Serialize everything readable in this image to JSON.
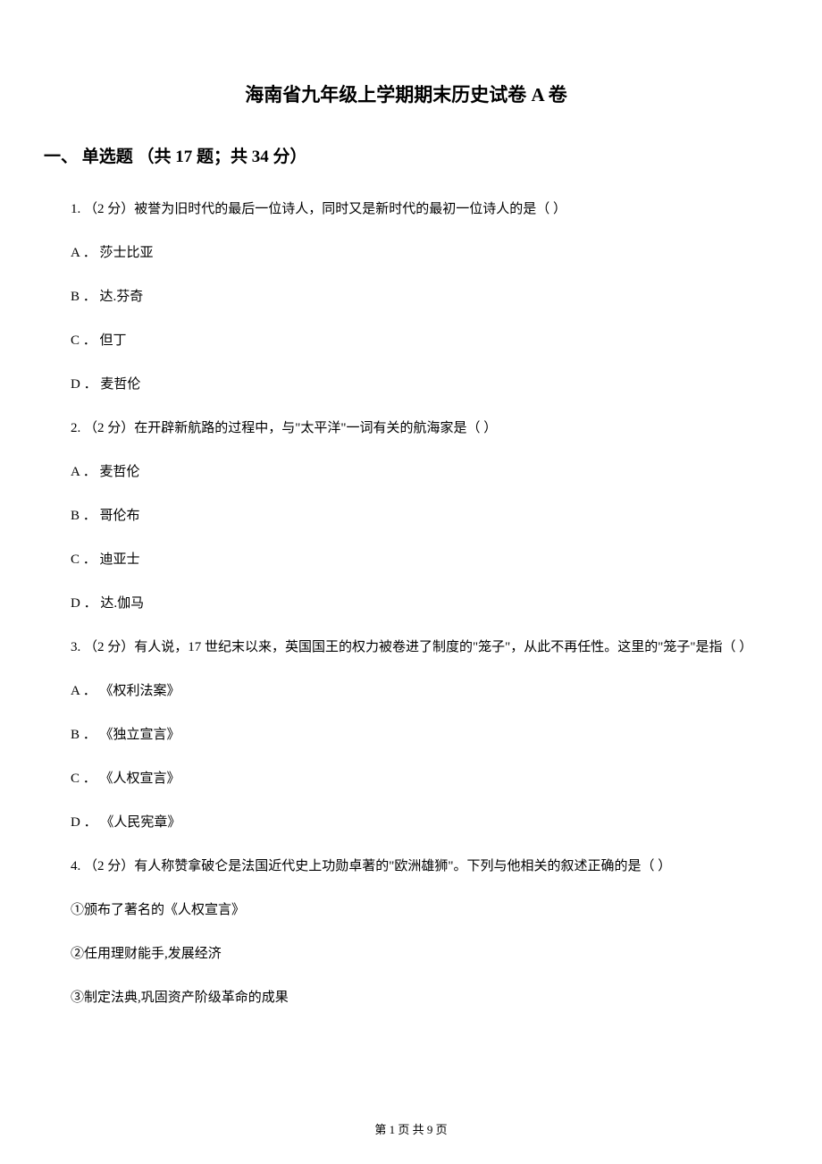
{
  "title": "海南省九年级上学期期末历史试卷 A 卷",
  "section_header": "一、 单选题 （共 17 题；共 34 分）",
  "questions": [
    {
      "prompt": "1. （2 分）被誉为旧时代的最后一位诗人，同时又是新时代的最初一位诗人的是（    ）",
      "options": [
        "A ． 莎士比亚",
        "B ． 达.芬奇",
        "C ． 但丁",
        "D ． 麦哲伦"
      ]
    },
    {
      "prompt": "2. （2 分）在开辟新航路的过程中，与\"太平洋\"一词有关的航海家是（    ）",
      "options": [
        "A ． 麦哲伦",
        "B ． 哥伦布",
        "C ． 迪亚士",
        "D ． 达.伽马"
      ]
    },
    {
      "prompt": "3. （2 分）有人说，17 世纪末以来，英国国王的权力被卷进了制度的\"笼子\"，从此不再任性。这里的\"笼子\"是指（    ）",
      "options": [
        "A ． 《权利法案》",
        "B ． 《独立宣言》",
        "C ． 《人权宣言》",
        "D ． 《人民宪章》"
      ]
    },
    {
      "prompt": "4. （2 分）有人称赞拿破仑是法国近代史上功勋卓著的\"欧洲雄狮\"。下列与他相关的叙述正确的是（    ）",
      "sub_items": [
        "①颁布了著名的《人权宣言》",
        "②任用理财能手,发展经济",
        "③制定法典,巩固资产阶级革命的成果"
      ]
    }
  ],
  "footer": "第 1 页 共 9 页"
}
